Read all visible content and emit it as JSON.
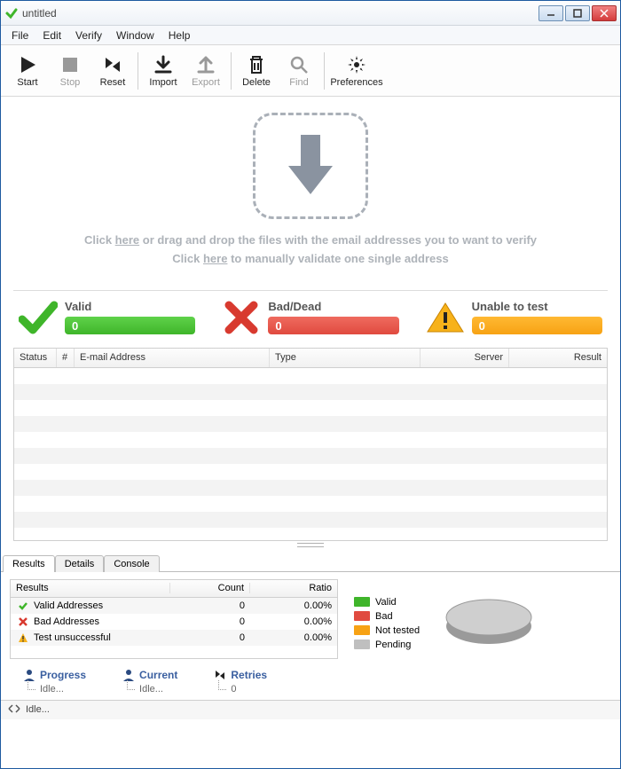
{
  "window": {
    "title": "untitled"
  },
  "menu": {
    "items": [
      "File",
      "Edit",
      "Verify",
      "Window",
      "Help"
    ]
  },
  "toolbar": {
    "start": "Start",
    "stop": "Stop",
    "reset": "Reset",
    "import": "Import",
    "export": "Export",
    "delete": "Delete",
    "find": "Find",
    "preferences": "Preferences"
  },
  "dropzone": {
    "line1a": "Click ",
    "line1link": "here",
    "line1b": " or drag and drop the files with the email addresses you to want to verify",
    "line2a": "Click ",
    "line2link": "here",
    "line2b": " to manually validate one single address"
  },
  "stats": {
    "valid": {
      "title": "Valid",
      "value": "0"
    },
    "bad": {
      "title": "Bad/Dead",
      "value": "0"
    },
    "unable": {
      "title": "Unable to test",
      "value": "0"
    }
  },
  "table": {
    "cols": {
      "status": "Status",
      "num": "#",
      "email": "E-mail Address",
      "type": "Type",
      "server": "Server",
      "result": "Result"
    }
  },
  "tabs": {
    "results": "Results",
    "details": "Details",
    "console": "Console"
  },
  "resultsPanel": {
    "head": {
      "results": "Results",
      "count": "Count",
      "ratio": "Ratio"
    },
    "rows": [
      {
        "label": "Valid Addresses",
        "count": "0",
        "ratio": "0.00%",
        "icon": "check"
      },
      {
        "label": "Bad Addresses",
        "count": "0",
        "ratio": "0.00%",
        "icon": "x"
      },
      {
        "label": "Test unsuccessful",
        "count": "0",
        "ratio": "0.00%",
        "icon": "warn"
      }
    ],
    "legend": [
      {
        "label": "Valid",
        "color": "#3fb52a"
      },
      {
        "label": "Bad",
        "color": "#e04a3f"
      },
      {
        "label": "Not tested",
        "color": "#f7a214"
      },
      {
        "label": "Pending",
        "color": "#bfbfbf"
      }
    ]
  },
  "metrics": {
    "progress": {
      "label": "Progress",
      "value": "Idle..."
    },
    "current": {
      "label": "Current",
      "value": "Idle..."
    },
    "retries": {
      "label": "Retries",
      "value": "0"
    }
  },
  "status": {
    "text": "Idle..."
  }
}
